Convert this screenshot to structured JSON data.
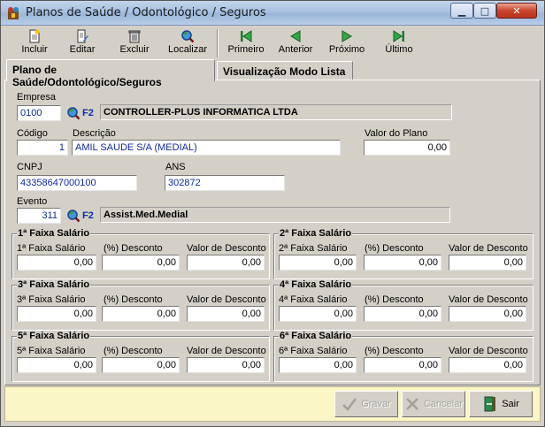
{
  "window": {
    "title": "Planos de Saúde / Odontológico / Seguros",
    "controls": {
      "minimize": "▁",
      "maximize": "□",
      "close": "✕"
    }
  },
  "toolbar": {
    "incluir": "Incluir",
    "editar": "Editar",
    "excluir": "Excluir",
    "localizar": "Localizar",
    "primeiro": "Primeiro",
    "anterior": "Anterior",
    "proximo": "Próximo",
    "ultimo": "Último"
  },
  "tabs": {
    "plano": "Plano de Saúde/Odontológico/Seguros",
    "lista": "Visualização Modo Lista"
  },
  "form": {
    "empresa": {
      "label": "Empresa",
      "code": "0100",
      "f2": "F2",
      "name": "CONTROLLER-PLUS INFORMATICA LTDA"
    },
    "codigo": {
      "label": "Código",
      "value": "1"
    },
    "descricao": {
      "label": "Descrição",
      "value": "AMIL SAUDE S/A (MEDIAL)"
    },
    "valor_plano": {
      "label": "Valor do Plano",
      "value": "0,00"
    },
    "cnpj": {
      "label": "CNPJ",
      "value": "43358647000100"
    },
    "ans": {
      "label": "ANS",
      "value": "302872"
    },
    "evento": {
      "label": "Evento",
      "code": "311",
      "f2": "F2",
      "name": "Assist.Med.Medial"
    }
  },
  "faixas": [
    {
      "title": "1ª Faixa Salário",
      "salario_label": "1ª Faixa Salário",
      "desconto_label": "(%) Desconto",
      "valor_label": "Valor de Desconto",
      "salario": "0,00",
      "desconto": "0,00",
      "valor": "0,00"
    },
    {
      "title": "2ª Faixa Salário",
      "salario_label": "2ª Faixa Salário",
      "desconto_label": "(%) Desconto",
      "valor_label": "Valor de Desconto",
      "salario": "0,00",
      "desconto": "0,00",
      "valor": "0,00"
    },
    {
      "title": "3ª Faixa Salário",
      "salario_label": "3ª Faixa Salário",
      "desconto_label": "(%) Desconto",
      "valor_label": "Valor de Desconto",
      "salario": "0,00",
      "desconto": "0,00",
      "valor": "0,00"
    },
    {
      "title": "4ª Faixa Salário",
      "salario_label": "4ª Faixa Salário",
      "desconto_label": "(%) Desconto",
      "valor_label": "Valor de Desconto",
      "salario": "0,00",
      "desconto": "0,00",
      "valor": "0,00"
    },
    {
      "title": "5ª Faixa Salário",
      "salario_label": "5ª Faixa Salário",
      "desconto_label": "(%) Desconto",
      "valor_label": "Valor de Desconto",
      "salario": "0,00",
      "desconto": "0,00",
      "valor": "0,00"
    },
    {
      "title": "6ª Faixa Salário",
      "salario_label": "6ª Faixa Salário",
      "desconto_label": "(%) Desconto",
      "valor_label": "Valor de Desconto",
      "salario": "0,00",
      "desconto": "0,00",
      "valor": "0,00"
    }
  ],
  "footer": {
    "gravar": "Gravar",
    "cancelar": "Cancelar",
    "sair": "Sair"
  },
  "colors": {
    "accent": "#102a9c",
    "footer_bg": "#fbf6c6",
    "window_bg": "#d4d0c8"
  }
}
